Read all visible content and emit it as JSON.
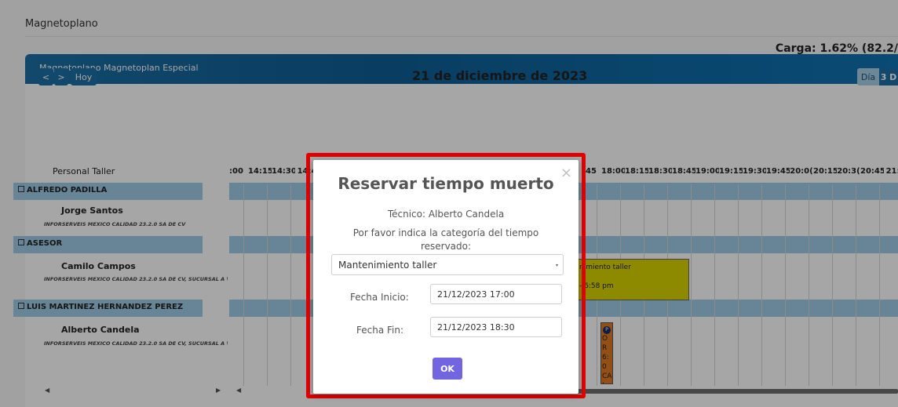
{
  "page": {
    "breadcrumb": "Magnetoplano"
  },
  "panel": {
    "title": "Magnetoplano Magnetoplan Especial",
    "load_text": "Carga: 1.62% (82.2/"
  },
  "calendar": {
    "prev_icon": "chevron-left-icon",
    "next_icon": "chevron-right-icon",
    "prev_label": "<",
    "next_label": ">",
    "today_label": "Hoy",
    "date_title": "21 de diciembre de 2023",
    "view_day": "Día",
    "view_3d": "3 D",
    "resource_header": "Personal Taller",
    "time_labels": [
      ":00",
      "14:15",
      "14:30",
      "14:4",
      "",
      "",
      "",
      "",
      "",
      "",
      "",
      "",
      "",
      "",
      "",
      ":45",
      "18:00",
      "18:15",
      "18:30",
      "18:45",
      "19:00",
      "19:15",
      "19:30",
      "19:45",
      "20:0(",
      "20:15",
      "20:3(",
      "20:45",
      "21:0"
    ],
    "groups": [
      {
        "name": "ALFREDO PADILLA",
        "person": "Jorge Santos",
        "company": "INFORSERVEIS MEXICO CALIDAD 23.2.0 SA DE CV"
      },
      {
        "name": "ASESOR",
        "person": "Camilo Campos",
        "company": "INFORSERVEIS MEXICO CALIDAD 23.2.0 SA DE CV, SUCURSAL A V"
      },
      {
        "name": "LUIS MARTINEZ HERNANDEZ PEREZ",
        "person": "Alberto Candela",
        "company": "INFORSERVEIS MEXICO CALIDAD 23.2.0 SA DE CV, SUCURSAL A V"
      }
    ],
    "event_yellow": {
      "line1": "nimiento taller",
      "line2": "- 6:58 pm"
    },
    "event_orange": {
      "badge": "P",
      "text": "OR 6:0 CA I M"
    },
    "scroll_left": "◀",
    "scroll_right": "▶"
  },
  "modal": {
    "title": "Reservar tiempo muerto",
    "close_label": "×",
    "technician": "Técnico: Alberto Candela",
    "prompt": "Por favor indica la categoría del tiempo reservado:",
    "category_selected": "Mantenimiento taller",
    "caret": "▾",
    "start_label": "Fecha Inicio:",
    "start_value": "21/12/2023 17:00",
    "end_label": "Fecha Fin:",
    "end_value": "21/12/2023 18:30",
    "ok_label": "OK"
  },
  "colors": {
    "header_blue": "#1b6fa6",
    "group_band": "#9ecde8",
    "highlight_red": "#e00000",
    "ok_purple": "#7364e0",
    "event_yellow": "#d9d400",
    "event_orange": "#e07b22"
  }
}
